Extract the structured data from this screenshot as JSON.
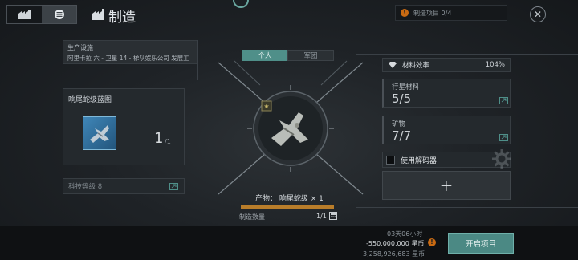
{
  "header": {
    "title": "制造",
    "queue_label": "制造项目 0/4"
  },
  "facility": {
    "label": "生产设施",
    "value": "阿里卡拉 六 - 卫星 14 - 梯队娱乐公司 发展工"
  },
  "blueprint": {
    "title": "响尾蛇级蓝图",
    "quantity": "1",
    "quantity_max": "/1"
  },
  "tech_level": "科技等级 8",
  "tabs": [
    "个人",
    "军团"
  ],
  "product": {
    "text": "产物： 响尾蛇级 × 1",
    "count_label": "制造数量",
    "count_value": "1/1",
    "progress": 1.0
  },
  "right": {
    "efficiency_label": "材料效率",
    "efficiency_value": "104%",
    "materials": [
      {
        "label": "行星材料",
        "value": "5/5"
      },
      {
        "label": "矿物",
        "value": "7/7"
      }
    ],
    "decoder_label": "使用解码器",
    "add_symbol": "+"
  },
  "bottom": {
    "time": "03天06小时",
    "cost": "-550,000,000 星币",
    "balance": "3,258,926,683 星币",
    "start_button": "开启项目"
  },
  "colors": {
    "accent": "#4b8984",
    "warning": "#c96a12",
    "progress": "#b97d2a"
  }
}
